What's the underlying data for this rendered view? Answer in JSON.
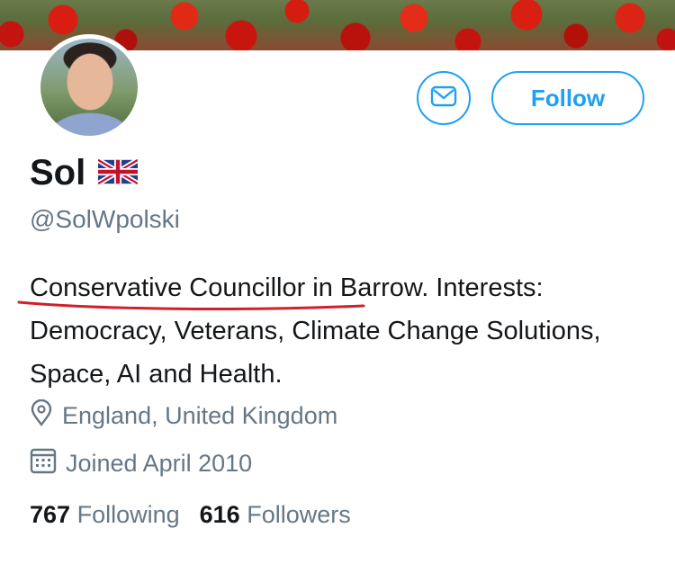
{
  "profile": {
    "name": "Sol",
    "handle": "@SolWpolski",
    "bio_highlight": "Conservative Councillor",
    "bio_rest": " in Barrow. Interests: Democracy, Veterans, Climate Change Solutions, Space, AI and Health.",
    "location": "England, United Kingdom",
    "joined": "Joined April 2010"
  },
  "actions": {
    "follow_label": "Follow"
  },
  "stats": {
    "following_count": "767",
    "following_label": "Following",
    "followers_count": "616",
    "followers_label": "Followers"
  },
  "icons": {
    "message": "envelope-icon",
    "flag": "uk-flag-icon",
    "location": "location-pin-icon",
    "joined": "calendar-icon"
  },
  "colors": {
    "accent": "#1da1f2",
    "secondary_text": "#657786",
    "annotation": "#d0202a"
  }
}
